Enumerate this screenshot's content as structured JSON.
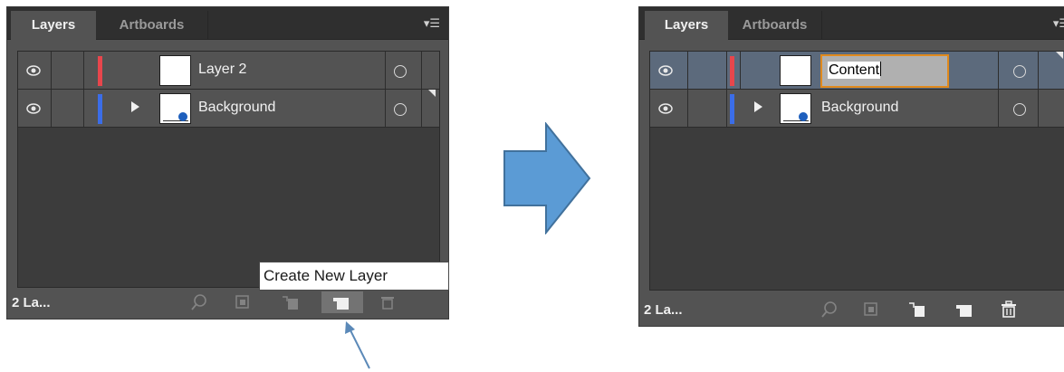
{
  "left_panel": {
    "tabs": {
      "active": "Layers",
      "inactive": "Artboards"
    },
    "menu_icon": "panel-menu-icon",
    "layers": [
      {
        "name": "Layer 2",
        "color": "#e8464c",
        "expandable": false,
        "thumbnail_dot": false
      },
      {
        "name": "Background",
        "color": "#3b6de8",
        "expandable": true,
        "thumbnail_dot": true
      }
    ],
    "footer": {
      "count": "2 La..."
    },
    "tooltip": "Create New Layer"
  },
  "right_panel": {
    "tabs": {
      "active": "Layers",
      "inactive": "Artboards"
    },
    "layers": [
      {
        "name_editing": "Content",
        "color": "#e8464c",
        "selected": true
      },
      {
        "name": "Background",
        "color": "#3b6de8",
        "expandable": true,
        "thumbnail_dot": true
      }
    ],
    "footer": {
      "count": "2 La..."
    }
  },
  "colors": {
    "panel_bg": "#535353",
    "tabbar_bg": "#2f2f2f",
    "arrow_fill": "#5b9bd5",
    "arrow_stroke": "#41719c",
    "pointer": "#5b89b8"
  },
  "icons": [
    "eye-icon",
    "expand-triangle-icon",
    "target-circle-icon",
    "search-icon",
    "make-clip-mask-icon",
    "create-sublayer-icon",
    "create-new-layer-icon",
    "delete-icon"
  ]
}
